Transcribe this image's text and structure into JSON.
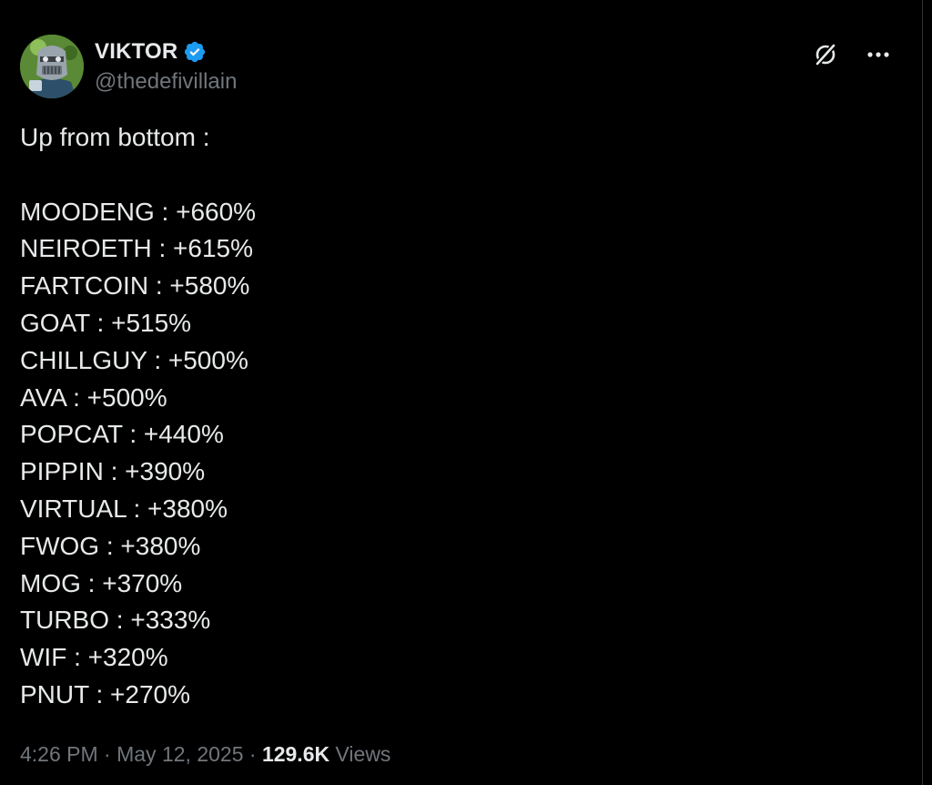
{
  "author": {
    "display_name": "VIKTOR",
    "handle": "@thedefivillain",
    "verified": true,
    "avatar_icon": "masked-villain-avatar"
  },
  "actions": {
    "grok_icon": "grok-slash-icon",
    "more_icon": "more-dots-icon"
  },
  "post": {
    "intro": "Up from bottom :",
    "items": [
      "MOODENG : +660%",
      "NEIROETH : +615%",
      "FARTCOIN : +580%",
      "GOAT : +515%",
      "CHILLGUY : +500%",
      "AVA : +500%",
      "POPCAT : +440%",
      "PIPPIN : +390%",
      "VIRTUAL : +380%",
      "FWOG : +380%",
      "MOG : +370%",
      "TURBO : +333%",
      "WIF : +320%",
      "PNUT : +270%"
    ]
  },
  "meta": {
    "time": "4:26 PM",
    "separator": "·",
    "date": "May 12, 2025",
    "views_count": "129.6K",
    "views_label": "Views"
  },
  "colors": {
    "background": "#000000",
    "text_primary": "#e7e9ea",
    "text_secondary": "#71767b",
    "verified_blue": "#1d9bf0"
  }
}
